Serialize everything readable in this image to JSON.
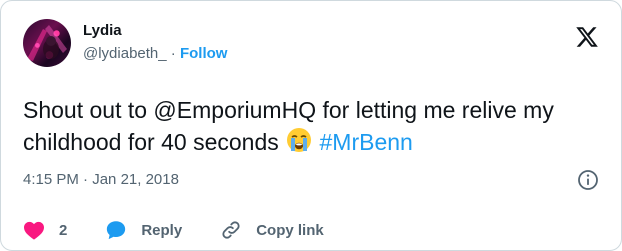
{
  "author": {
    "name": "Lydia",
    "handle": "@lydiabeth_",
    "separator": "·",
    "follow_label": "Follow"
  },
  "tweet": {
    "text_before": "Shout out to @EmporiumHQ for letting me relive my childhood for 40 seconds",
    "hashtag": "#MrBenn",
    "emoji": "loudly-crying-face"
  },
  "meta": {
    "time": "4:15 PM",
    "separator": "·",
    "date": "Jan 21, 2018"
  },
  "actions": {
    "like_count": "2",
    "reply_label": "Reply",
    "copy_link_label": "Copy link"
  },
  "colors": {
    "accent": "#1d9bf0",
    "like": "#f91880",
    "muted": "#536471",
    "text": "#0f1419"
  }
}
